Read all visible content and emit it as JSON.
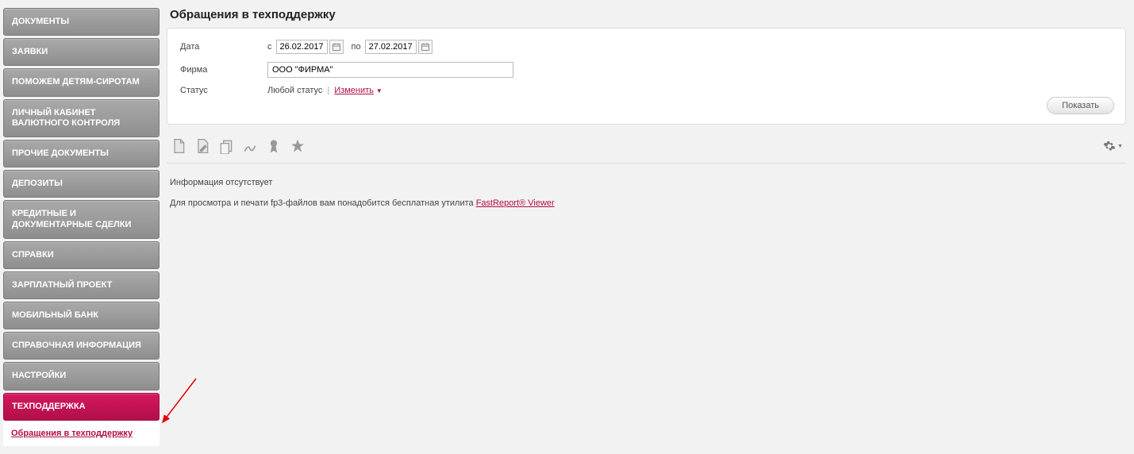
{
  "sidebar": {
    "items": [
      {
        "label": "ДОКУМЕНТЫ"
      },
      {
        "label": "ЗАЯВКИ"
      },
      {
        "label": "ПОМОЖЕМ ДЕТЯМ-СИРОТАМ"
      },
      {
        "label": "ЛИЧНЫЙ КАБИНЕТ ВАЛЮТНОГО КОНТРОЛЯ"
      },
      {
        "label": "ПРОЧИЕ ДОКУМЕНТЫ"
      },
      {
        "label": "ДЕПОЗИТЫ"
      },
      {
        "label": "КРЕДИТНЫЕ И ДОКУМЕНТАРНЫЕ СДЕЛКИ"
      },
      {
        "label": "СПРАВКИ"
      },
      {
        "label": "ЗАРПЛАТНЫЙ ПРОЕКТ"
      },
      {
        "label": "МОБИЛЬНЫЙ БАНК"
      },
      {
        "label": "СПРАВОЧНАЯ ИНФОРМАЦИЯ"
      },
      {
        "label": "НАСТРОЙКИ"
      },
      {
        "label": "ТЕХПОДДЕРЖКА",
        "active": true
      }
    ],
    "sublink": "Обращения в техподдержку"
  },
  "page": {
    "title": "Обращения в техподдержку"
  },
  "filter": {
    "date_label": "Дата",
    "from_prefix": "с",
    "to_prefix": "по",
    "date_from": "26.02.2017",
    "date_to": "27.02.2017",
    "firm_label": "Фирма",
    "firm_value": "ООО \"ФИРМА\"",
    "status_label": "Статус",
    "status_value": "Любой статус",
    "status_change": "Изменить",
    "show_button": "Показать"
  },
  "content": {
    "empty_text": "Информация отсутствует",
    "hint_prefix": "Для просмотра и печати fp3-файлов вам понадобится бесплатная утилита ",
    "hint_link": "FastReport® Viewer"
  }
}
